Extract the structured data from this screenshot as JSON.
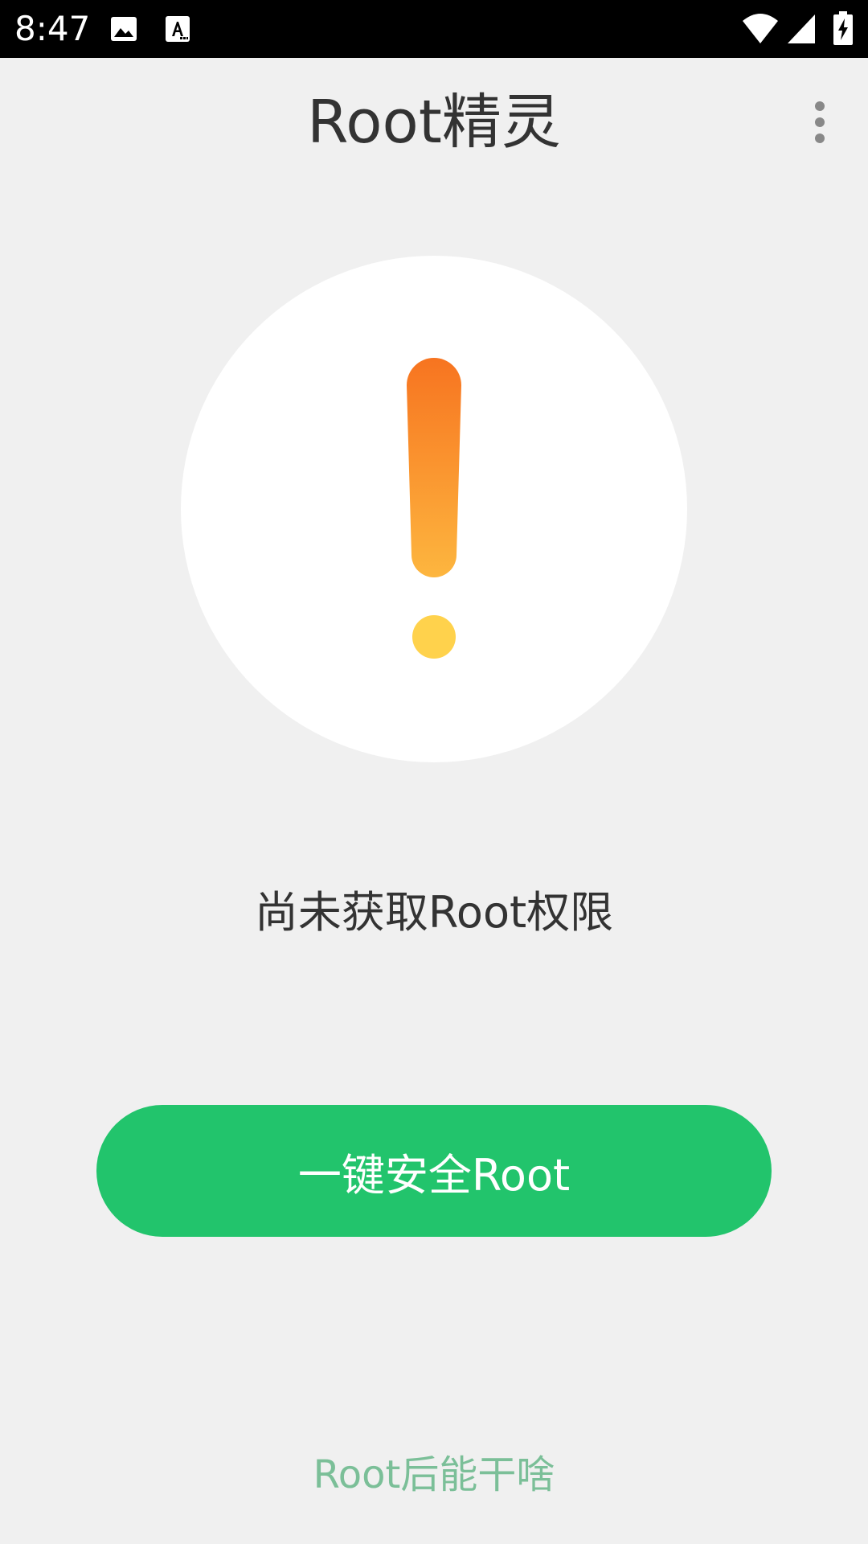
{
  "status_bar": {
    "time": "8:47",
    "icons": [
      "image-notification-icon",
      "text-notification-icon",
      "wifi-icon",
      "cellular-signal-icon",
      "battery-charging-icon"
    ]
  },
  "app_bar": {
    "title": "Root精灵",
    "menu_icon": "more-vert-icon"
  },
  "status_panel": {
    "icon": "warning-exclamation-icon",
    "message": "尚未获取Root权限"
  },
  "primary_action": {
    "label": "一键安全Root"
  },
  "help_link": {
    "label": "Root后能干啥"
  },
  "colors": {
    "background": "#f0f0f0",
    "primary_button": "#22c46c",
    "help_link": "#7bbf98",
    "warning_top": "#f77420",
    "warning_bottom": "#ffd24c"
  }
}
